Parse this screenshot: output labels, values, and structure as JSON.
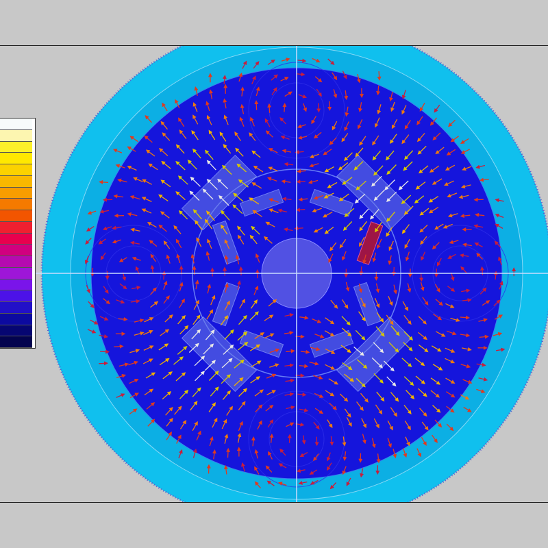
{
  "colors": {
    "background": "#c8c8c8",
    "outer_ring": "#10c0ee",
    "middle_ring": "#0cafe4",
    "inner_disk": "#1515dc",
    "crosshair": "#c9dcff",
    "highlight_block": "#9e1546"
  },
  "legend": {
    "swatches": [
      "#f7fbfb",
      "#fdf6b0",
      "#fcf02a",
      "#ffe800",
      "#fbd200",
      "#f9b800",
      "#f79d00",
      "#f57a00",
      "#f25500",
      "#ef2030",
      "#e8004e",
      "#d1007f",
      "#b50bb0",
      "#9e16d8",
      "#7a14ea",
      "#4c12e8",
      "#2210c8",
      "#0c0aa0",
      "#060672",
      "#03034e"
    ]
  },
  "field": {
    "outer_ring": "stator-yoke",
    "middle_ring": "air-gap",
    "inner_disk": "rotor-core",
    "shaft": "shaft",
    "magnets": "rotor-magnets",
    "vectors": "flux-density-arrows"
  }
}
